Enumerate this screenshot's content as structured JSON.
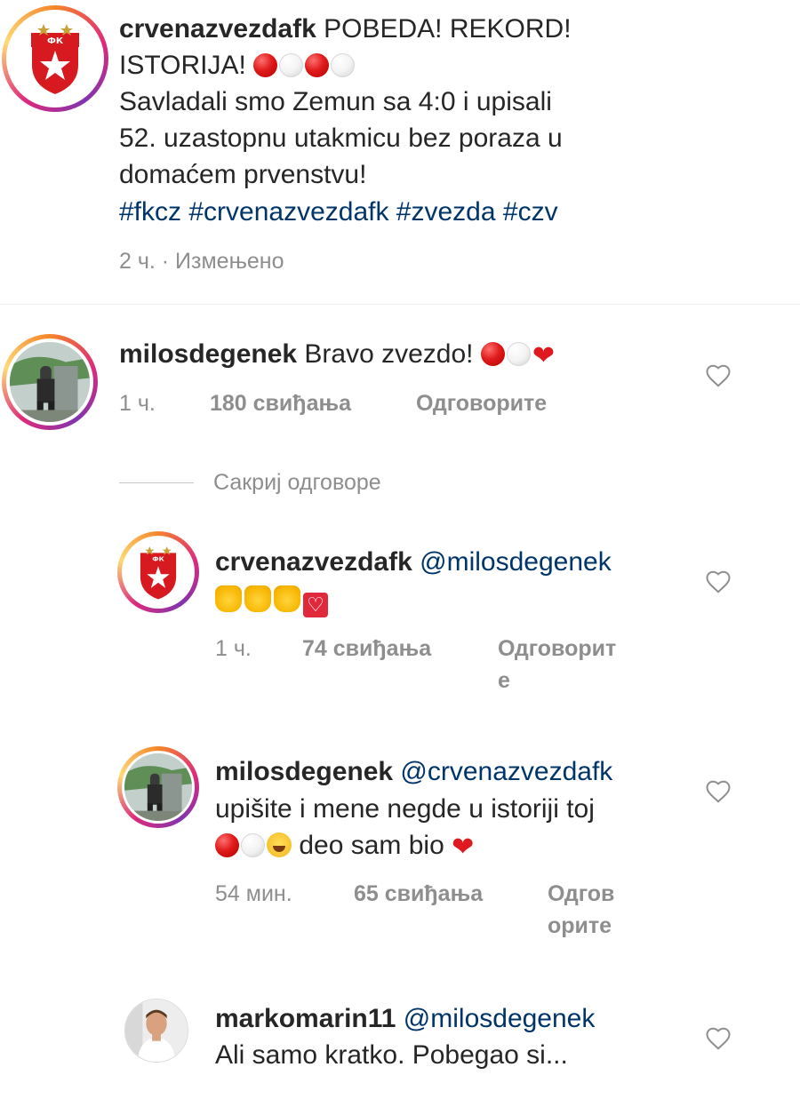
{
  "post": {
    "username": "crvenazvezdafk",
    "caption_line1": "POBEDA! REKORD!",
    "caption_line2": "ISTORIJA!",
    "caption_line3": "Savladali smo Zemun sa 4:0 i upisali",
    "caption_line4": "52. uzastopnu utakmicu bez poraza u",
    "caption_line5": "domaćem prvenstvu!",
    "hashtags": "#fkcz #crvenazvezdafk #zvezda #czv",
    "time": "2 ч.",
    "edited": "· Измењено"
  },
  "comments": [
    {
      "username": "milosdegenek",
      "text": "Bravo zvezdo!",
      "time": "1 ч.",
      "likes": "180 свиђања",
      "reply": "Одговорите"
    }
  ],
  "hide_replies": "Сакриј одговоре",
  "replies": [
    {
      "username": "crvenazvezdafk",
      "mention": "@milosdegenek",
      "time": "1 ч.",
      "likes": "74 свиђања",
      "reply_line1": "Одговорит",
      "reply_line2": "е"
    },
    {
      "username": "milosdegenek",
      "mention": "@crvenazvezdafk",
      "line2": "upišite i mene negde u istoriji toj",
      "line3": "deo sam bio",
      "time": "54 мин.",
      "likes": "65 свиђања",
      "reply_line1": "Одгов",
      "reply_line2": "орите"
    },
    {
      "username": "markomarin11",
      "mention": "@milosdegenek",
      "line2": "Ali samo kratko. Pobegao si..."
    }
  ],
  "icons": {
    "emoji_ball_red": "red-circle-icon",
    "emoji_ball_white": "white-circle-icon",
    "emoji_heart": "red-heart-icon",
    "emoji_clap": "clapping-hands-icon",
    "emoji_laugh": "face-with-tears-of-joy-icon",
    "like": "heart-outline-icon"
  },
  "colors": {
    "text": "#262626",
    "meta": "#8e8e8e",
    "link": "#003569",
    "club_red": "#d71920"
  }
}
